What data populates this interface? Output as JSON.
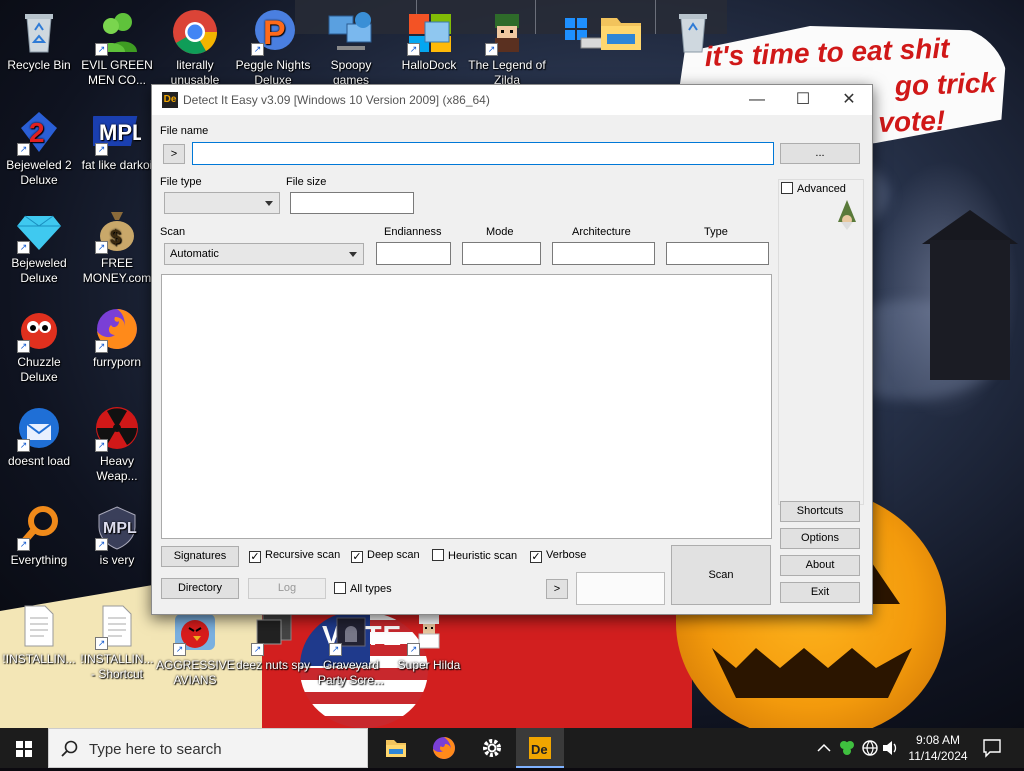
{
  "wallpaper": {
    "speech_line1": "it's time to eat shit",
    "speech_line2": "go trick",
    "speech_line3": "vote!",
    "flag_text": "VOTE"
  },
  "desktop_icons": [
    {
      "name": "recycle-bin",
      "label": "Recycle Bin"
    },
    {
      "name": "evil-green-men",
      "label": "EVIL GREEN MEN CO..."
    },
    {
      "name": "literally-unusable",
      "label": "literally unusable"
    },
    {
      "name": "peggle-nights",
      "label": "Peggle Nights Deluxe"
    },
    {
      "name": "spoopy-games",
      "label": "Spoopy games"
    },
    {
      "name": "hallodock",
      "label": "HalloDock"
    },
    {
      "name": "legend-of-zilda",
      "label": "The Legend of Zilda"
    },
    {
      "name": "bejeweled-2",
      "label": "Bejeweled 2 Deluxe"
    },
    {
      "name": "fat-like-darkoi",
      "label": "fat like darkoi"
    },
    {
      "name": "bejeweled",
      "label": "Bejeweled Deluxe"
    },
    {
      "name": "free-money",
      "label": "FREE MONEY.com"
    },
    {
      "name": "chuzzle",
      "label": "Chuzzle Deluxe"
    },
    {
      "name": "furryporn",
      "label": "furryporn"
    },
    {
      "name": "doesnt-load",
      "label": "doesnt load"
    },
    {
      "name": "heavy-weap",
      "label": "Heavy Weap..."
    },
    {
      "name": "everything",
      "label": "Everything"
    },
    {
      "name": "is-very",
      "label": "is very"
    },
    {
      "name": "installing-1",
      "label": "!INSTALLIN..."
    },
    {
      "name": "installing-2",
      "label": "!INSTALLIN... - Shortcut"
    },
    {
      "name": "aggressive-avians",
      "label": "AGGRESSIVE AVIANS"
    },
    {
      "name": "deez-nuts-spy",
      "label": "deez nuts spy"
    },
    {
      "name": "graveyard",
      "label": "Graveyard Party Scre..."
    },
    {
      "name": "super-hilda",
      "label": "Super Hilda"
    }
  ],
  "window": {
    "title": "Detect It Easy v3.09 [Windows 10 Version 2009] (x86_64)",
    "logo": "De",
    "minimize": "—",
    "maximize": "☐",
    "close": "✕",
    "file_name_label": "File name",
    "file_name_value": "",
    "browse_arrow": ">",
    "browse_button": "...",
    "file_type_label": "File type",
    "file_type_value": "",
    "file_size_label": "File size",
    "file_size_value": "",
    "scan_label": "Scan",
    "scan_value": "Automatic",
    "endianness_label": "Endianness",
    "mode_label": "Mode",
    "architecture_label": "Architecture",
    "type_label": "Type",
    "advanced_label": "Advanced",
    "signatures_button": "Signatures",
    "recursive_scan": "Recursive scan",
    "deep_scan": "Deep scan",
    "heuristic_scan": "Heuristic scan",
    "verbose": "Verbose",
    "directory_button": "Directory",
    "log_button": "Log",
    "all_types": "All types",
    "arrow_button": ">",
    "scan_button": "Scan",
    "shortcuts_button": "Shortcuts",
    "options_button": "Options",
    "about_button": "About",
    "exit_button": "Exit",
    "checks": {
      "recursive": true,
      "deep": true,
      "heuristic": false,
      "verbose": true,
      "all_types": false,
      "advanced": false
    }
  },
  "taskbar": {
    "search_placeholder": "Type here to search",
    "time": "9:08 AM",
    "date": "11/14/2024"
  },
  "colors": {
    "taskbar": "#1c1c1c",
    "accent": "#0078d7",
    "window_bg": "#f0f0f0"
  }
}
